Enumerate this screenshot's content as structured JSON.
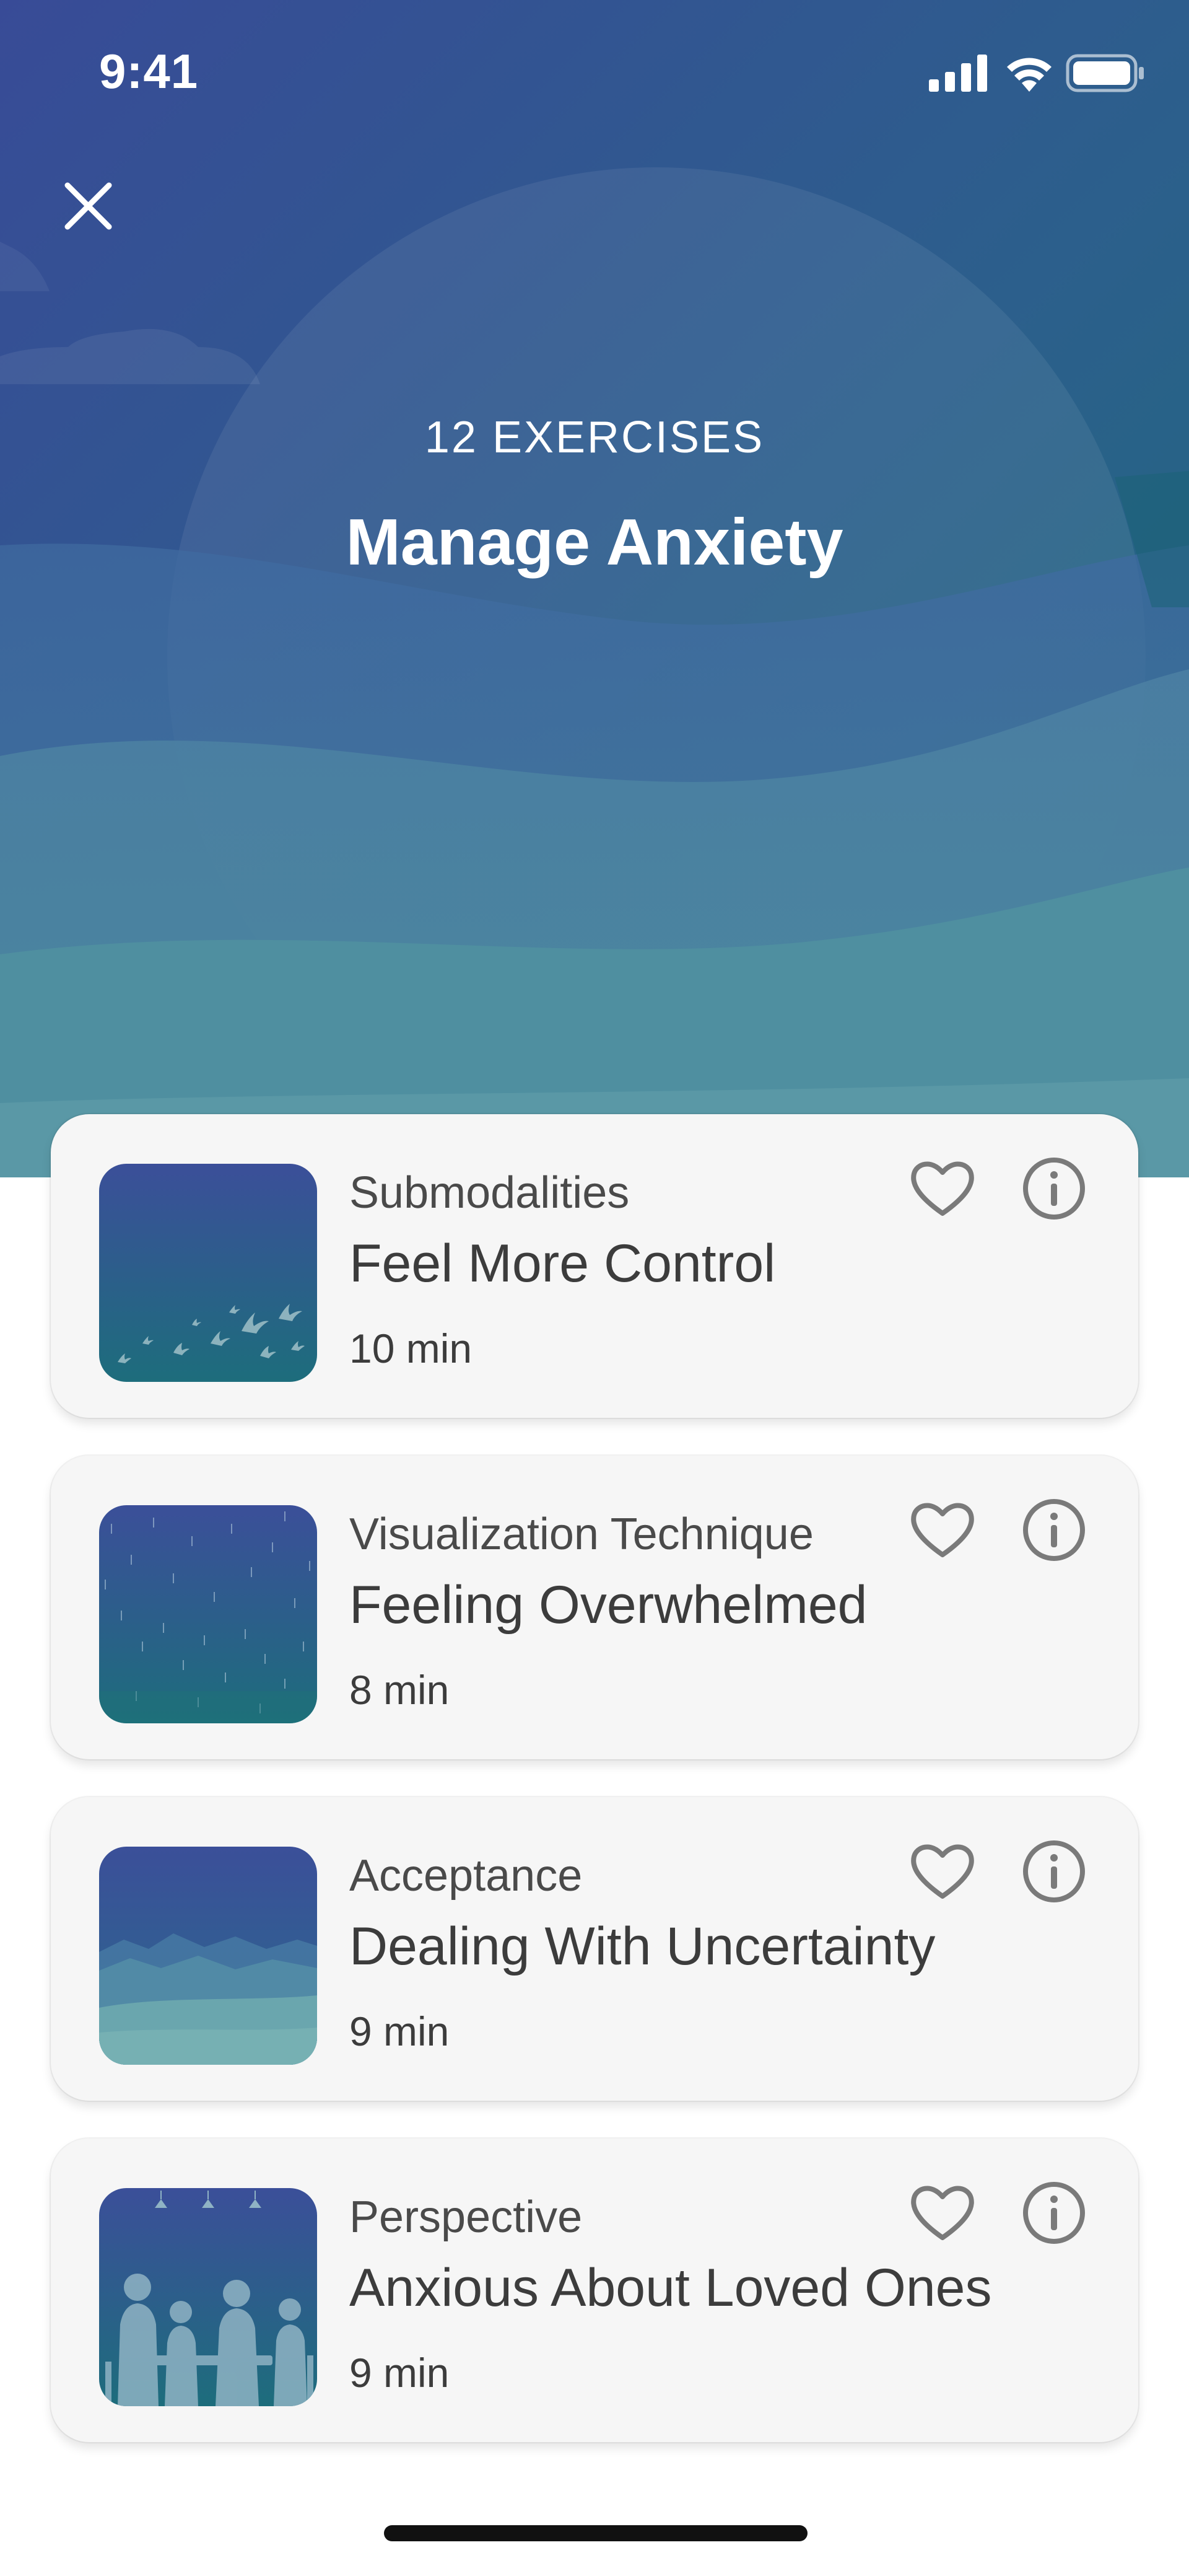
{
  "status_bar": {
    "time": "9:41"
  },
  "header": {
    "exercise_count": "12 EXERCISES",
    "title": "Manage Anxiety"
  },
  "exercises": [
    {
      "category": "Submodalities",
      "title": "Feel More Control",
      "duration": "10 min",
      "thumbnail": "birds-flying"
    },
    {
      "category": "Visualization Technique",
      "title": "Feeling Overwhelmed",
      "duration": "8 min",
      "thumbnail": "rain"
    },
    {
      "category": "Acceptance",
      "title": "Dealing With Uncertainty",
      "duration": "9 min",
      "thumbnail": "misty-mountains"
    },
    {
      "category": "Perspective",
      "title": "Anxious About Loved Ones",
      "duration": "9 min",
      "thumbnail": "family-at-table"
    }
  ],
  "icons": {
    "close": "close-icon",
    "favorite": "heart-icon",
    "info": "info-icon",
    "signal": "cellular-signal-icon",
    "wifi": "wifi-icon",
    "battery": "battery-icon"
  },
  "colors": {
    "hero_top": "#3a4e96",
    "hero_bottom": "#4a8e95",
    "card_background": "#f6f6f6",
    "icon_gray": "#7a7a7a",
    "text_dark": "#3c3c3c"
  }
}
